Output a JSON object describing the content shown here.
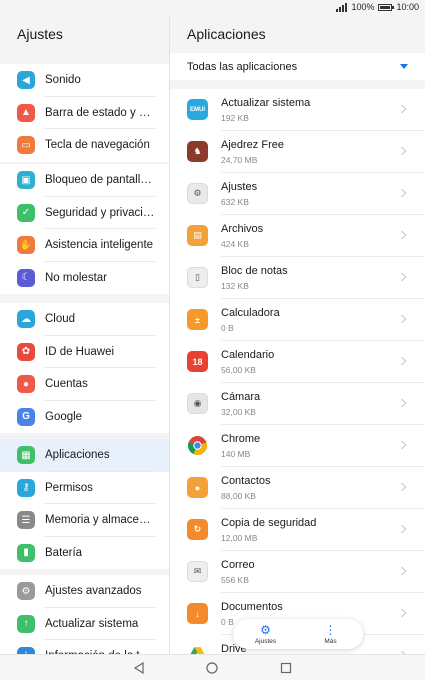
{
  "status": {
    "battery": "100%",
    "time": "10:00"
  },
  "left": {
    "title": "Ajustes",
    "groups": [
      [
        {
          "label": "Sonido",
          "icon": "speaker-icon",
          "color": "#2aa7d8",
          "glyph": "◀"
        },
        {
          "label": "Barra de estado y notificaciones",
          "icon": "bell-icon",
          "color": "#f0584a",
          "glyph": "▲"
        },
        {
          "label": "Tecla de navegación",
          "icon": "nav-key-icon",
          "color": "#f07a3c",
          "glyph": "▭"
        }
      ],
      [
        {
          "label": "Bloqueo de pantalla y contraseñas",
          "icon": "lock-icon",
          "color": "#2fb0cf",
          "glyph": "▣"
        },
        {
          "label": "Seguridad y privacidad",
          "icon": "shield-icon",
          "color": "#3fbf6a",
          "glyph": "✓"
        },
        {
          "label": "Asistencia inteligente",
          "icon": "hand-icon",
          "color": "#f07a3c",
          "glyph": "✋"
        },
        {
          "label": "No molestar",
          "icon": "moon-icon",
          "color": "#5b5bd6",
          "glyph": "☾"
        }
      ],
      [
        {
          "label": "Cloud",
          "icon": "cloud-icon",
          "color": "#2aa7d8",
          "glyph": "☁"
        },
        {
          "label": "ID de Huawei",
          "icon": "huawei-icon",
          "color": "#e84a3f",
          "glyph": "✿"
        },
        {
          "label": "Cuentas",
          "icon": "account-icon",
          "color": "#f0584a",
          "glyph": "●"
        },
        {
          "label": "Google",
          "icon": "google-icon",
          "color": "#4b83e8",
          "glyph": "G"
        }
      ],
      [
        {
          "label": "Aplicaciones",
          "icon": "apps-icon",
          "color": "#3fbf6a",
          "glyph": "▦",
          "active": true
        },
        {
          "label": "Permisos",
          "icon": "key-icon",
          "color": "#2aa7d8",
          "glyph": "⚷"
        },
        {
          "label": "Memoria y almacenamiento",
          "icon": "storage-icon",
          "color": "#8a8a8a",
          "glyph": "☰"
        },
        {
          "label": "Batería",
          "icon": "battery-icon",
          "color": "#3fbf6a",
          "glyph": "▮"
        }
      ],
      [
        {
          "label": "Ajustes avanzados",
          "icon": "gear-icon",
          "color": "#9a9a9a",
          "glyph": "⚙"
        },
        {
          "label": "Actualizar sistema",
          "icon": "update-icon",
          "color": "#3fbf6a",
          "glyph": "↑"
        },
        {
          "label": "Información de la tableta",
          "icon": "info-icon",
          "color": "#2a8ad8",
          "glyph": "i"
        }
      ]
    ]
  },
  "right": {
    "title": "Aplicaciones",
    "filter": "Todas las aplicaciones",
    "apps": [
      {
        "name": "Actualizar sistema",
        "size": "192 KB",
        "icon": "emui-icon",
        "color": "#29a9e0",
        "glyph": "EMUI"
      },
      {
        "name": "Ajedrez Free",
        "size": "24,70 MB",
        "icon": "chess-icon",
        "color": "#8c3a2a",
        "glyph": "♞"
      },
      {
        "name": "Ajustes",
        "size": "632 KB",
        "icon": "settings-icon",
        "color": "#e9e9e9",
        "glyph": "⚙",
        "dark": true
      },
      {
        "name": "Archivos",
        "size": "424 KB",
        "icon": "folder-icon",
        "color": "#f5a13a",
        "glyph": "▤"
      },
      {
        "name": "Bloc de notas",
        "size": "132 KB",
        "icon": "notepad-icon",
        "color": "#eeeeee",
        "glyph": "▯",
        "dark": true
      },
      {
        "name": "Calculadora",
        "size": "0 B",
        "icon": "calculator-icon",
        "color": "#f59a2a",
        "glyph": "±"
      },
      {
        "name": "Calendario",
        "size": "56,00 KB",
        "icon": "calendar-icon",
        "color": "#e8412f",
        "glyph": "18"
      },
      {
        "name": "Cámara",
        "size": "32,00 KB",
        "icon": "camera-icon",
        "color": "#e6e6e6",
        "glyph": "◉",
        "dark": true
      },
      {
        "name": "Chrome",
        "size": "140 MB",
        "icon": "chrome-icon",
        "color": "#ffffff",
        "glyph": "",
        "chrome": true
      },
      {
        "name": "Contactos",
        "size": "88,00 KB",
        "icon": "contacts-icon",
        "color": "#f5a13a",
        "glyph": "●"
      },
      {
        "name": "Copia de seguridad",
        "size": "12,00 MB",
        "icon": "backup-icon",
        "color": "#f58a2a",
        "glyph": "↻"
      },
      {
        "name": "Correo",
        "size": "556 KB",
        "icon": "mail-icon",
        "color": "#eeeeee",
        "glyph": "✉",
        "dark": true
      },
      {
        "name": "Documentos",
        "size": "0 B",
        "icon": "download-icon",
        "color": "#f58a2a",
        "glyph": "↓"
      },
      {
        "name": "Drive",
        "size": "",
        "icon": "drive-icon",
        "color": "#ffffff",
        "glyph": "▲",
        "drive": true
      }
    ]
  },
  "popup": {
    "settings_label": "Ajustes",
    "more_label": "Más"
  }
}
